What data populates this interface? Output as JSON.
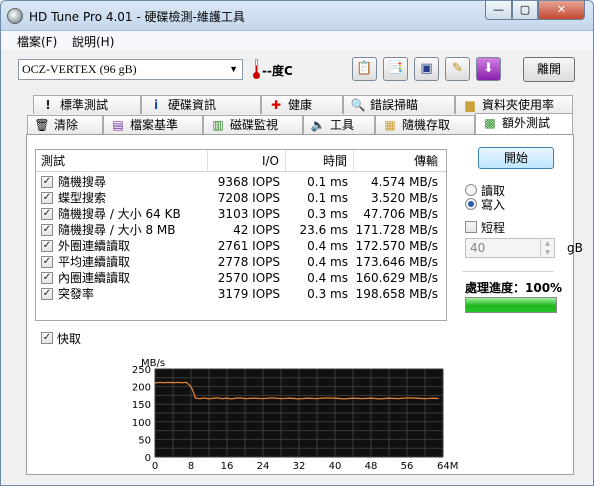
{
  "window": {
    "title": "HD Tune Pro 4.01 - 硬碟檢測-維護工具"
  },
  "menu": {
    "file": "檔案(F)",
    "help": "說明(H)"
  },
  "toolbar": {
    "drive": "OCZ-VERTEX (96 gB)",
    "temperature": "--度C",
    "exit_label": "離開"
  },
  "tabs_top": [
    {
      "label": "標準測試",
      "icon": "exclamation-icon"
    },
    {
      "label": "硬碟資訊",
      "icon": "info-icon"
    },
    {
      "label": "健康",
      "icon": "red-cross-icon"
    },
    {
      "label": "錯誤掃瞄",
      "icon": "magnifier-icon"
    },
    {
      "label": "資料夾使用率",
      "icon": "folder-icon"
    }
  ],
  "tabs_bottom": [
    {
      "label": "清除",
      "icon": "trash-icon"
    },
    {
      "label": "檔案基準",
      "icon": "file-benchmark-icon"
    },
    {
      "label": "磁碟監視",
      "icon": "monitor-icon"
    },
    {
      "label": "工具",
      "icon": "speaker-icon"
    },
    {
      "label": "隨機存取",
      "icon": "random-access-icon"
    },
    {
      "label": "額外測試",
      "icon": "extra-tests-icon"
    }
  ],
  "list": {
    "headers": {
      "test": "測試",
      "io": "I/O",
      "time": "時間",
      "transfer": "傳輸"
    },
    "rows": [
      {
        "name": "隨機搜尋",
        "io": "9368 IOPS",
        "time": "0.1 ms",
        "transfer": "4.574 MB/s"
      },
      {
        "name": "蝶型搜索",
        "io": "7208 IOPS",
        "time": "0.1 ms",
        "transfer": "3.520 MB/s"
      },
      {
        "name": "隨機搜尋 / 大小 64 KB",
        "io": "3103 IOPS",
        "time": "0.3 ms",
        "transfer": "47.706 MB/s"
      },
      {
        "name": "隨機搜尋 / 大小 8 MB",
        "io": "42 IOPS",
        "time": "23.6 ms",
        "transfer": "171.728 MB/s"
      },
      {
        "name": "外圈連續讀取",
        "io": "2761 IOPS",
        "time": "0.4 ms",
        "transfer": "172.570 MB/s"
      },
      {
        "name": "平均連續讀取",
        "io": "2778 IOPS",
        "time": "0.4 ms",
        "transfer": "173.646 MB/s"
      },
      {
        "name": "內圈連續讀取",
        "io": "2570 IOPS",
        "time": "0.4 ms",
        "transfer": "160.629 MB/s"
      },
      {
        "name": "突發率",
        "io": "3179 IOPS",
        "time": "0.3 ms",
        "transfer": "198.658 MB/s"
      }
    ]
  },
  "controls": {
    "start_label": "開始",
    "read_label": "讀取",
    "write_label": "寫入",
    "short_label": "短程",
    "size_value": "40",
    "size_unit": "gB",
    "progress_label": "處理進度：100%",
    "progress_value": 1.0,
    "cache_label": "快取"
  },
  "chart_data": {
    "type": "line",
    "ylabel": "MB/s",
    "xlabel": "MB",
    "ylim": [
      0,
      250
    ],
    "xlim": [
      0,
      64
    ],
    "y_ticks": [
      0,
      50,
      100,
      150,
      200,
      250
    ],
    "x_ticks": [
      "0",
      "8",
      "16",
      "24",
      "32",
      "40",
      "48",
      "56",
      "64MB"
    ],
    "x": [
      0,
      1,
      2,
      3,
      4,
      5,
      6,
      7,
      8,
      8.5,
      9,
      10,
      11,
      12,
      13,
      14,
      15,
      16,
      17,
      18,
      19,
      20,
      22,
      24,
      26,
      28,
      30,
      32,
      34,
      36,
      38,
      40,
      42,
      44,
      46,
      48,
      50,
      52,
      54,
      56,
      58,
      60,
      62,
      63
    ],
    "series": [
      {
        "values": [
          210,
          212,
          211,
          212,
          211,
          212,
          211,
          212,
          200,
          185,
          167,
          166,
          168,
          165,
          167,
          168,
          166,
          167,
          165,
          167,
          168,
          166,
          167,
          166,
          168,
          166,
          167,
          165,
          167,
          166,
          168,
          167,
          165,
          167,
          166,
          167,
          165,
          167,
          166,
          168,
          167,
          166,
          167,
          166
        ]
      }
    ],
    "grid": true,
    "line_color": "#e08030"
  }
}
